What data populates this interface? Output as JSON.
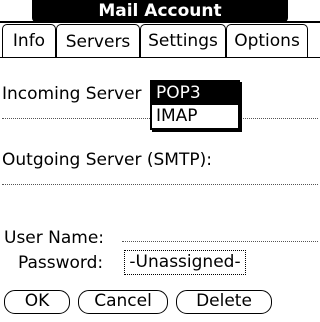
{
  "title": "Mail Account",
  "tabs": [
    {
      "label": "Info"
    },
    {
      "label": "Servers"
    },
    {
      "label": "Settings"
    },
    {
      "label": "Options"
    }
  ],
  "active_tab": "Servers",
  "incoming": {
    "label": "Incoming Server",
    "popup_options": [
      "POP3",
      "IMAP"
    ],
    "selected": "POP3"
  },
  "outgoing": {
    "label": "Outgoing Server (SMTP):"
  },
  "username": {
    "label": "User Name:"
  },
  "password": {
    "label": "Password:",
    "value": "-Unassigned-"
  },
  "buttons": {
    "ok": "OK",
    "cancel": "Cancel",
    "delete": "Delete"
  }
}
